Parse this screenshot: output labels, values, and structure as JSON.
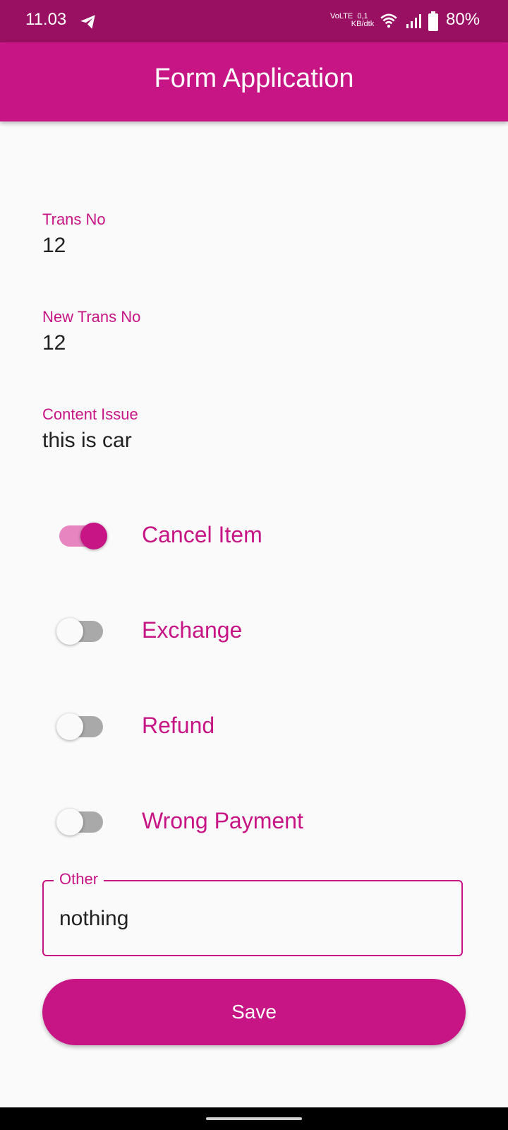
{
  "status_bar": {
    "time": "11.03",
    "network_type": "VoLTE",
    "net_speed": "0,1 KB/dtk",
    "battery": "80%",
    "icons": [
      "telegram-icon",
      "wifi-icon",
      "signal-icon",
      "battery-icon"
    ]
  },
  "app_bar": {
    "title": "Form Application"
  },
  "form": {
    "trans_no": {
      "label": "Trans No",
      "value": "12"
    },
    "new_trans_no": {
      "label": "New Trans No",
      "value": "12"
    },
    "content_issue": {
      "label": "Content Issue",
      "value": "this is car"
    },
    "switches": [
      {
        "label": "Cancel Item",
        "on": true
      },
      {
        "label": "Exchange",
        "on": false
      },
      {
        "label": "Refund",
        "on": false
      },
      {
        "label": "Wrong Payment",
        "on": false
      }
    ],
    "other": {
      "label": "Other",
      "value": "nothing"
    },
    "save_label": "Save"
  },
  "colors": {
    "primary": "#c71585",
    "status_bar": "#990f62",
    "background": "#fafafa",
    "switch_off_track": "#a9a9a9",
    "switch_on_track": "#e685c0"
  }
}
